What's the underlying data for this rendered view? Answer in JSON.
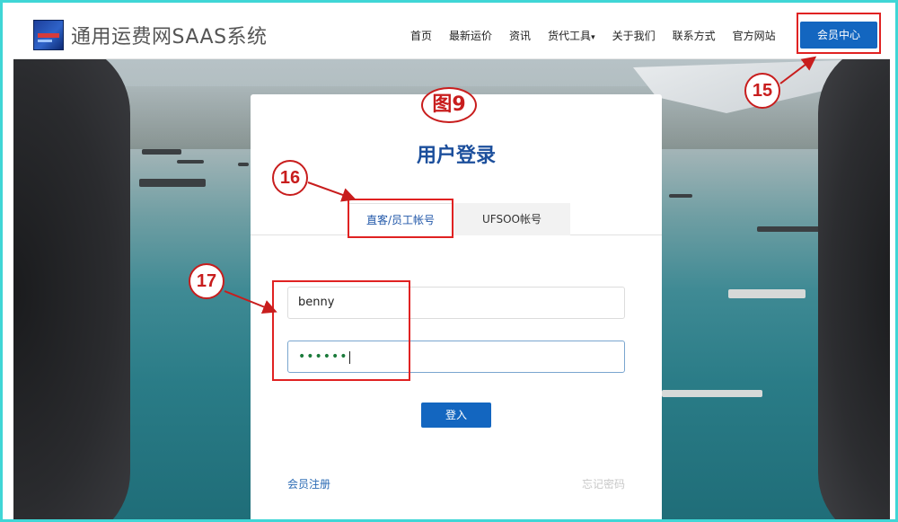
{
  "header": {
    "site_title": "通用运费网SAAS系统",
    "nav": [
      "首页",
      "最新运价",
      "资讯",
      "货代工具",
      "关于我们",
      "联系方式",
      "官方网站"
    ],
    "member_center": "会员中心"
  },
  "login": {
    "title": "用户登录",
    "tabs": [
      "直客/员工帐号",
      "UFSOO帐号"
    ],
    "username_value": "benny",
    "password_mask": "••••••",
    "submit_label": "登入",
    "register_label": "会员注册",
    "forgot_label": "忘记密码"
  },
  "annotations": {
    "figure_label": "图9",
    "markers": [
      "15",
      "16",
      "17"
    ],
    "color": "#e02222"
  },
  "colors": {
    "brand_blue": "#1366c0",
    "title_blue": "#1c4f9c",
    "frame": "#3fd6d6"
  }
}
